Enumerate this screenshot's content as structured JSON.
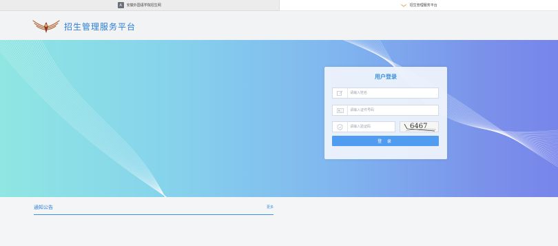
{
  "browser": {
    "tabs": [
      {
        "label": "安徽外国语学院招生网",
        "favicon": "letter-a-icon",
        "active": false
      },
      {
        "label": "招生管理服务平台",
        "favicon": "wing-logo-icon",
        "active": true
      }
    ]
  },
  "header": {
    "logo": "wing-logo-icon",
    "title": "招生管理服务平台"
  },
  "login": {
    "title": "用户登录",
    "name_placeholder": "请输入姓名",
    "id_placeholder": "请输入证件号码",
    "captcha_placeholder": "请输入验证码",
    "captcha_code": "6467",
    "submit_label": "登 录"
  },
  "notice": {
    "title": "通知公告",
    "more_label": "更多"
  },
  "colors": {
    "accent": "#3a8fe0",
    "button": "#4f9cf0",
    "banner_start": "#8fe6e2",
    "banner_end": "#7785ea"
  }
}
